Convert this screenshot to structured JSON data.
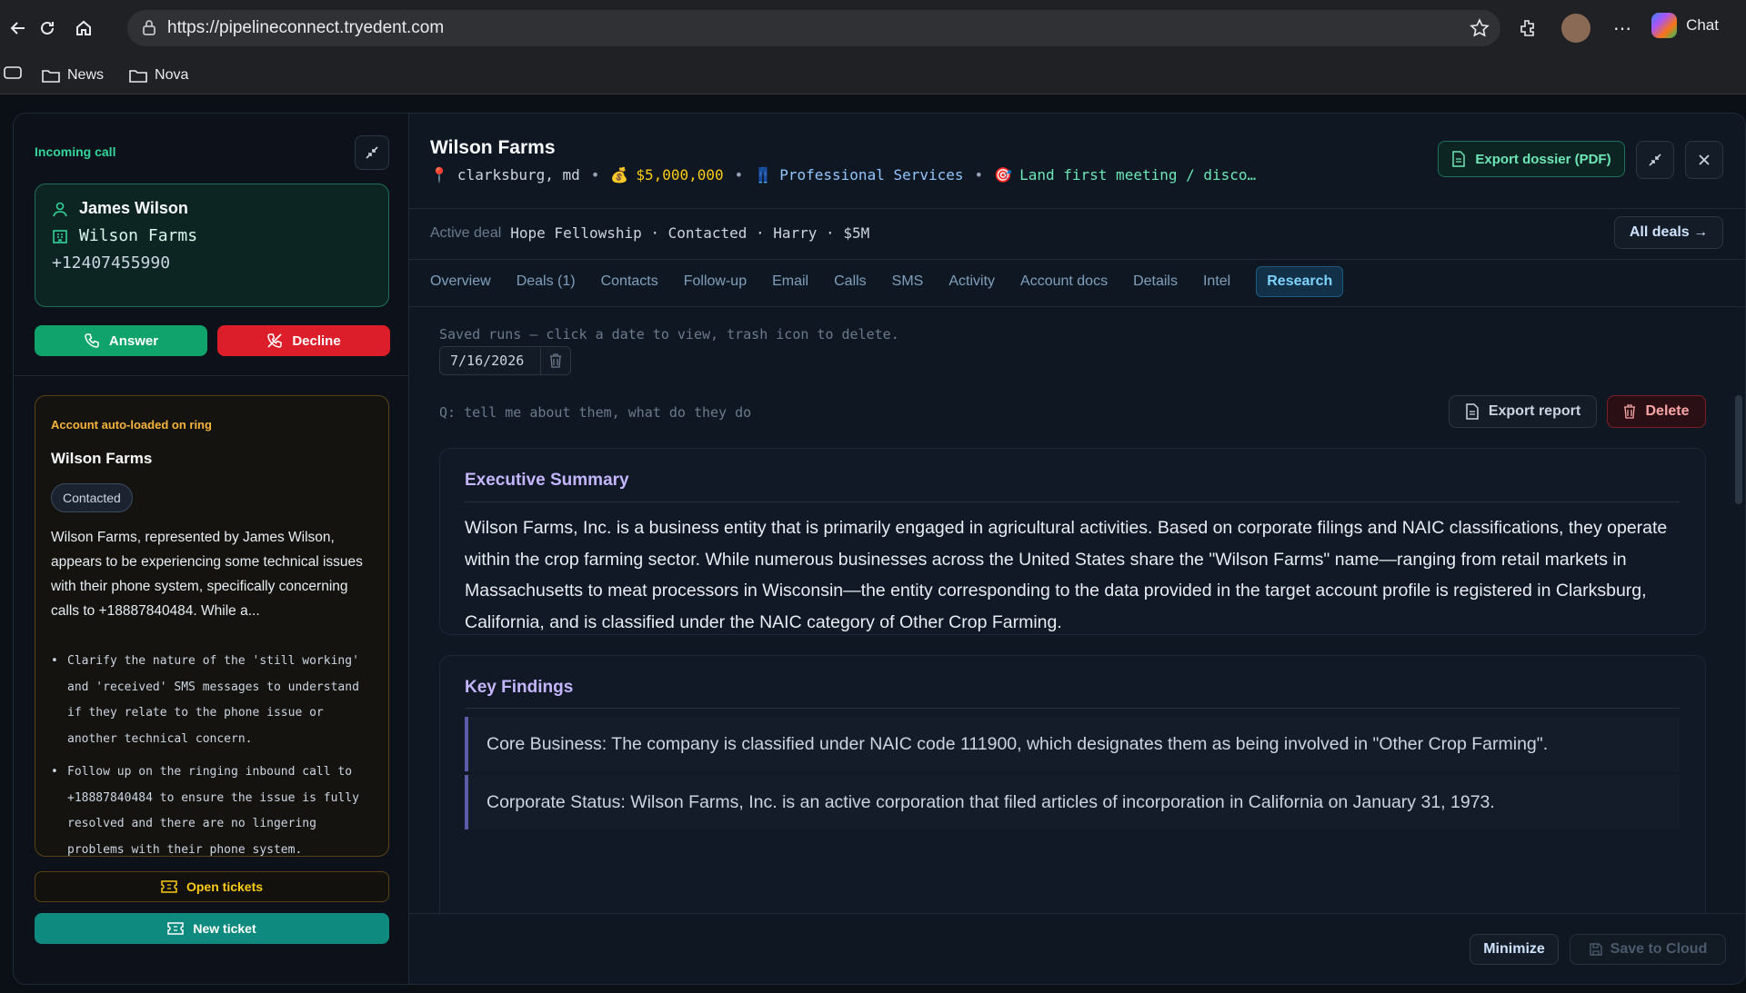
{
  "browser": {
    "url": "https://pipelineconnect.tryedent.com",
    "bookmarks": [
      "News",
      "Nova"
    ],
    "chat_label": "Chat"
  },
  "call": {
    "incoming_label": "Incoming call",
    "caller_name": "James Wilson",
    "caller_company": "Wilson Farms",
    "caller_phone": "+12407455990",
    "answer_label": "Answer",
    "decline_label": "Decline"
  },
  "account": {
    "autoload_label": "Account auto-loaded on ring",
    "name": "Wilson Farms",
    "status": "Contacted",
    "summary": "Wilson Farms, represented by James Wilson, appears to be experiencing some technical issues with their phone system, specifically concerning calls to +18887840484. While a...",
    "bullets": [
      "Clarify the nature of the 'still working' and 'received' SMS messages to understand if they relate to the phone issue or another technical concern.",
      "Follow up on the ringing inbound call to +18887840484 to ensure the issue is fully resolved and there are no lingering problems with their phone system."
    ],
    "open_tickets_label": "Open tickets",
    "new_ticket_label": "New ticket"
  },
  "header": {
    "title": "Wilson Farms",
    "location": "clarksburg, md",
    "value": "$5,000,000",
    "industry": "Professional Services",
    "goal": "Land first meeting / disco…",
    "export_dossier_label": "Export dossier (PDF)"
  },
  "deal": {
    "label": "Active deal",
    "text": "Hope Fellowship · Contacted · Harry · $5M",
    "all_deals_label": "All deals →"
  },
  "tabs": [
    "Overview",
    "Deals (1)",
    "Contacts",
    "Follow-up",
    "Email",
    "Calls",
    "SMS",
    "Activity",
    "Account docs",
    "Details",
    "Intel",
    "Research"
  ],
  "research": {
    "saved_runs_hint": "Saved runs — click a date to view, trash icon to delete.",
    "run_date": "7/16/2026",
    "question": "Q: tell me about them, what do they do",
    "export_report_label": "Export report",
    "delete_label": "Delete",
    "executive_summary_heading": "Executive Summary",
    "executive_summary": "Wilson Farms, Inc. is a business entity that is primarily engaged in agricultural activities. Based on corporate filings and NAIC classifications, they operate within the crop farming sector. While numerous businesses across the United States share the \"Wilson Farms\" name—ranging from retail markets in Massachusetts to meat processors in Wisconsin—the entity corresponding to the data provided in the target account profile is registered in Clarksburg, California, and is classified under the NAIC category of Other Crop Farming.",
    "key_findings_heading": "Key Findings",
    "findings": [
      "Core Business: The company is classified under NAIC code 111900, which designates them as being involved in \"Other Crop Farming\".",
      "Corporate Status: Wilson Farms, Inc. is an active corporation that filed articles of incorporation in California on January 31, 1973."
    ]
  },
  "footer": {
    "minimize_label": "Minimize",
    "save_cloud_label": "Save to Cloud"
  },
  "colors": {
    "accent_green": "#10a36b",
    "decline_red": "#dc1e2a",
    "teal": "#0f8a7e",
    "heading_purple": "#c4b5fd",
    "active_tab": "#7dd3fc"
  }
}
